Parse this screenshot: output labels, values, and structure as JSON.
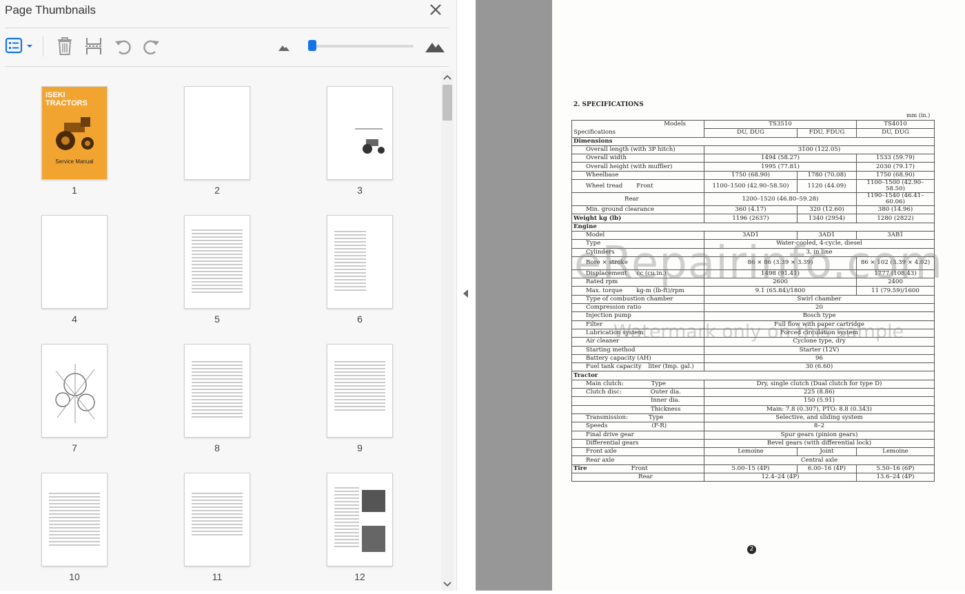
{
  "panel": {
    "title": "Page Thumbnails",
    "close_icon": "close-icon",
    "toolbar": {
      "options_icon": "thumbnail-options-icon",
      "delete_icon": "trash-icon",
      "extract_icon": "extract-pages-icon",
      "undo_icon": "rotate-counterclockwise-icon",
      "redo_icon": "rotate-clockwise-icon",
      "zoom_out_icon": "small-mountain-icon",
      "zoom_in_icon": "large-mountain-icon",
      "zoom_level": 0.0
    },
    "thumbnails": [
      {
        "label": "1",
        "cover_title": "ISEKI TRACTORS",
        "cover_subtitle": "Service Manual"
      },
      {
        "label": "2"
      },
      {
        "label": "3"
      },
      {
        "label": "4"
      },
      {
        "label": "5"
      },
      {
        "label": "6"
      },
      {
        "label": "7"
      },
      {
        "label": "8"
      },
      {
        "label": "9"
      },
      {
        "label": "10"
      },
      {
        "label": "11"
      },
      {
        "label": "12"
      }
    ]
  },
  "colors": {
    "accent": "#1473e6",
    "cover": "#f2a431"
  },
  "document": {
    "section_title": "2. SPECIFICATIONS",
    "unit": "mm (in.)",
    "page_number": "2",
    "watermark_main": "eRepairinfo.com",
    "watermark_sub": "Watermark only on this sample",
    "header": {
      "models": "Models",
      "specifications": "Specifications",
      "ts3510": "TS3510",
      "ts4010": "TS4010",
      "du_dug": "DU, DUG",
      "fdu_fdug": "FDU, FDUG",
      "du_dug2": "DU, DUG"
    },
    "rows": {
      "dimensions": "Dimensions",
      "overall_length": "Overall length (with 3P hitch)",
      "overall_length_v": "3100 (122.05)",
      "overall_width": "Overall width",
      "overall_width_v1": "1494 (58.27)",
      "overall_width_v2": "1533 (59.79)",
      "overall_height": "Overall height (with muffler)",
      "overall_height_v1": "1995 (77.81)",
      "overall_height_v2": "2030 (79.17)",
      "wheelbase": "Wheelbase",
      "wheelbase_v1": "1750 (68.90)",
      "wheelbase_v2": "1780 (70.08)",
      "wheelbase_v3": "1750 (68.90)",
      "wheel_tread": "Wheel tread",
      "front": "Front",
      "tread_front_v1": "1100–1500 (42.90–58.50)",
      "tread_front_v2": "1120 (44.09)",
      "tread_front_v3": "1100–1500 (42.90–58.50)",
      "rear": "Rear",
      "tread_rear_v1": "1200–1520 (46.80–59.28)",
      "tread_rear_v2": "1190–1540 (46.41–60.06)",
      "min_ground": "Min. ground clearance",
      "min_ground_v1": "360 (4.17)",
      "min_ground_v2": "320 (12.60)",
      "min_ground_v3": "380 (14.96)",
      "weight": "Weight  kg (lb)",
      "weight_v1": "1196 (2637)",
      "weight_v2": "1340 (2954)",
      "weight_v3": "1280 (2822)",
      "engine": "Engine",
      "model": "Model",
      "model_v1": "3AD1",
      "model_v2": "3AD1",
      "model_v3": "3AB1",
      "type": "Type",
      "type_v": "Water-cooled, 4-cycle, diesel",
      "cylinders": "Cylinders",
      "cylinders_v": "3, in line",
      "bore": "Bore × stroke",
      "bore_v1": "86 × 86 (3.39 × 3.39)",
      "bore_v2": "86 × 102 (3.39 × 4.02)",
      "displacement": "Displacement",
      "displacement_unit": "cc (cu.in.)",
      "displacement_v1": "1498 (91.41)",
      "displacement_v2": "1777 (108.43)",
      "rated_rpm": "Rated rpm",
      "rated_rpm_v1": "2600",
      "rated_rpm_v2": "2400",
      "max_torque": "Max. torque",
      "max_torque_unit": "kg-m (lb-ft)/rpm",
      "max_torque_v1": "9.1 (65.84)/1800",
      "max_torque_v2": "11 (79.59)/1600",
      "combustion": "Type of combustion chamber",
      "combustion_v": "Swirl chamber",
      "compression": "Compression ratio",
      "compression_v": "20",
      "injection": "Injection pump",
      "injection_v": "Bosch type",
      "filter": "Filter",
      "filter_v": "Full flow with paper cartridge",
      "lubrication": "Lubrication system",
      "lubrication_v": "Forced circulation system",
      "air_cleaner": "Air cleaner",
      "air_cleaner_v": "Cyclone type, dry",
      "starting": "Starting method",
      "starting_v": "Starter (12V)",
      "battery": "Battery capacity (AH)",
      "battery_v": "96",
      "fuel_tank": "Fuel tank capacity",
      "fuel_tank_unit": "liter (Imp. gal.)",
      "fuel_tank_v": "30 (6.60)",
      "tractor": "Tractor",
      "main_clutch": "Main clutch:",
      "main_clutch_type": "Type",
      "main_clutch_v": "Dry, single clutch (Dual clutch for type D)",
      "clutch_disc": "Clutch disc:",
      "outer_dia": "Outer dia.",
      "outer_dia_v": "225 (8.86)",
      "inner_dia": "Inner dia.",
      "inner_dia_v": "150 (5.91)",
      "thickness": "Thickness",
      "thickness_v": "Main: 7.8 (0.307), PTO: 8.8 (0.343)",
      "transmission": "Transmission:",
      "transmission_type": "Type",
      "transmission_v": "Selective, and sliding system",
      "speeds": "Speeds",
      "speeds_unit": "(F-R)",
      "speeds_v": "8–2",
      "final_drive": "Final drive gear",
      "final_drive_v": "Spur gears (pinion gears)",
      "differential": "Differential gears",
      "differential_v": "Bevel gears (with differential lock)",
      "front_axle": "Front axle",
      "front_axle_v1": "Lemoine",
      "front_axle_v2": "Joint",
      "front_axle_v3": "Lemoine",
      "rear_axle": "Rear axle",
      "rear_axle_v": "Central axle",
      "tire": "Tire",
      "tire_front": "Front",
      "tire_front_v1": "5.00–15 (4P)",
      "tire_front_v2": "6.00–16 (4P)",
      "tire_front_v3": "5.50–16 (6P)",
      "tire_rear": "Rear",
      "tire_rear_v1": "12.4–24 (4P)",
      "tire_rear_v2": "13.6–24 (4P)"
    }
  }
}
